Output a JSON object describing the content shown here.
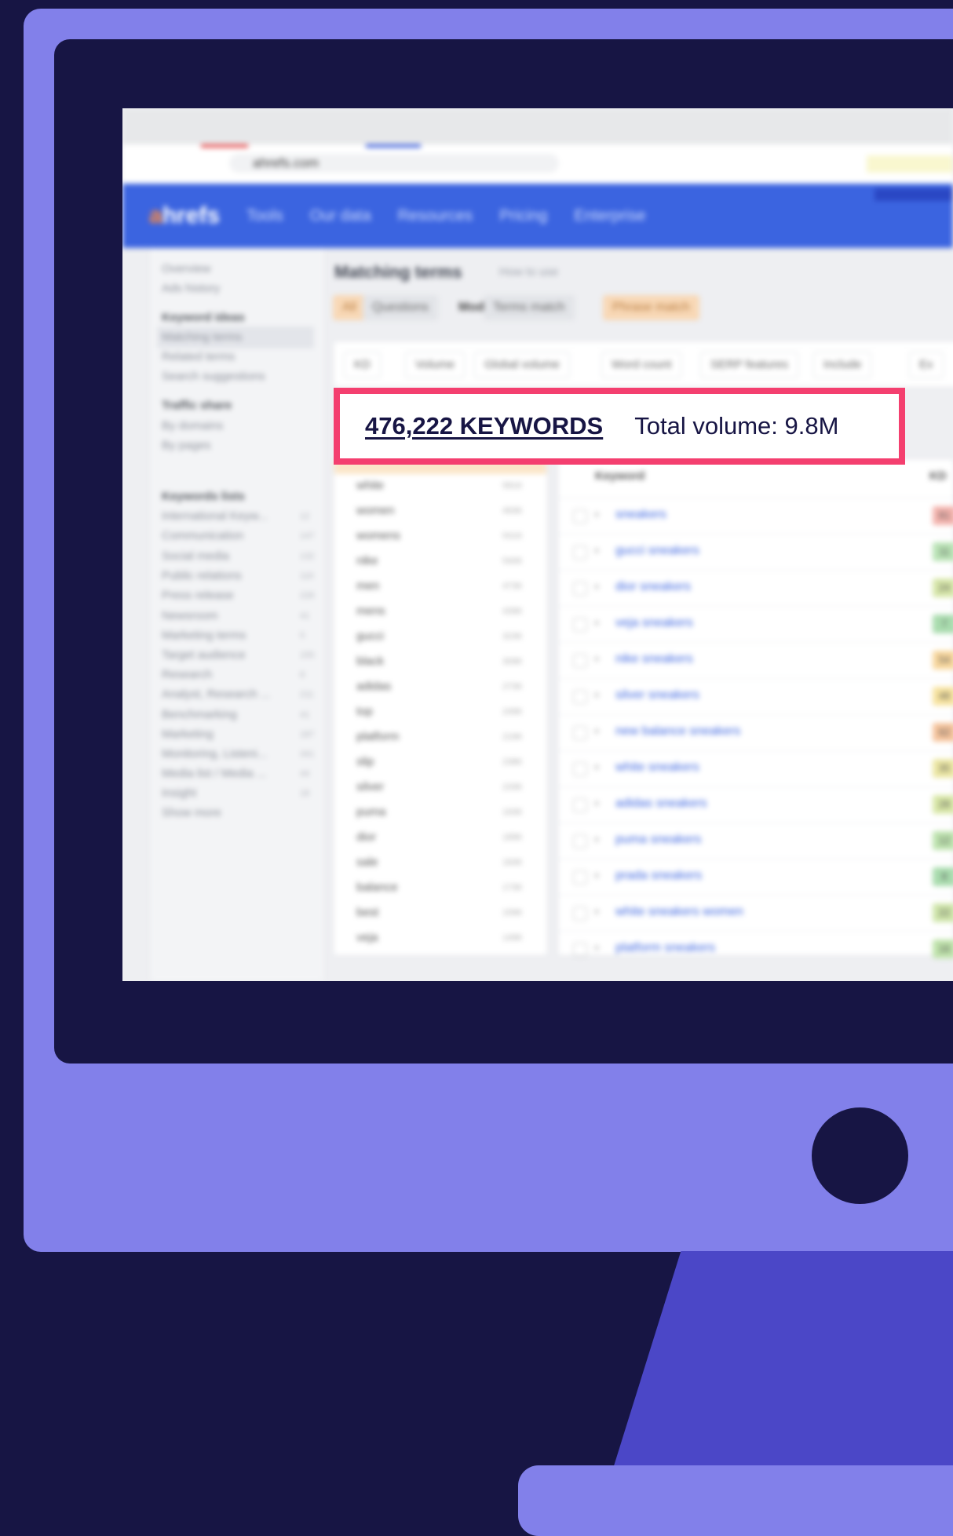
{
  "browser": {
    "url": "ahrefs.com"
  },
  "nav": {
    "logo_a": "a",
    "logo_rest": "hrefs",
    "items": [
      "Tools",
      "Our data",
      "Resources",
      "Pricing",
      "Enterprise"
    ]
  },
  "sidebar": {
    "items": [
      {
        "label": "Overview",
        "head": false
      },
      {
        "label": "Ads history",
        "head": false
      },
      {
        "label": "Keyword ideas",
        "head": true
      },
      {
        "label": "Matching terms",
        "head": false,
        "active": true
      },
      {
        "label": "Related terms",
        "head": false
      },
      {
        "label": "Search suggestions",
        "head": false
      },
      {
        "label": "Traffic share",
        "head": true
      },
      {
        "label": "By domains",
        "head": false
      },
      {
        "label": "By pages",
        "head": false
      },
      {
        "label": "Keywords lists",
        "head": true
      },
      {
        "label": "International Keyw...",
        "head": false,
        "count": "12"
      },
      {
        "label": "Communication",
        "head": false,
        "count": "147"
      },
      {
        "label": "Social media",
        "head": false,
        "count": "132"
      },
      {
        "label": "Public relations",
        "head": false,
        "count": "116"
      },
      {
        "label": "Press release",
        "head": false,
        "count": "228"
      },
      {
        "label": "Newsroom",
        "head": false,
        "count": "41"
      },
      {
        "label": "Marketing terms",
        "head": false,
        "count": "5"
      },
      {
        "label": "Target audience",
        "head": false,
        "count": "155"
      },
      {
        "label": "Research",
        "head": false,
        "count": "8"
      },
      {
        "label": "Analyst, Research ...",
        "head": false,
        "count": "211"
      },
      {
        "label": "Benchmarking",
        "head": false,
        "count": "41"
      },
      {
        "label": "Marketing",
        "head": false,
        "count": "187"
      },
      {
        "label": "Monitoring, Listeni...",
        "head": false,
        "count": "341"
      },
      {
        "label": "Media list / Media ...",
        "head": false,
        "count": "44"
      },
      {
        "label": "Insight",
        "head": false,
        "count": "18"
      },
      {
        "label": "Show more",
        "head": false
      }
    ]
  },
  "main": {
    "title": "Matching terms",
    "how_to": "How to use",
    "tabs": [
      {
        "label": "All",
        "style": "orange"
      },
      {
        "label": "Questions",
        "style": "grey"
      },
      {
        "label": "Mode",
        "style": "plain"
      },
      {
        "label": "Terms match",
        "style": "grey"
      },
      {
        "label": "Phrase match",
        "style": "orange"
      }
    ],
    "filters": [
      "KD",
      "Volume",
      "Global volume",
      "Word count",
      "SERP features",
      "Include",
      "Ex"
    ]
  },
  "terms": [
    {
      "term": "white",
      "count": "581K"
    },
    {
      "term": "women",
      "count": "493K"
    },
    {
      "term": "womens",
      "count": "541K"
    },
    {
      "term": "nike",
      "count": "540K"
    },
    {
      "term": "men",
      "count": "473K"
    },
    {
      "term": "mens",
      "count": "439K"
    },
    {
      "term": "gucci",
      "count": "323K"
    },
    {
      "term": "black",
      "count": "309K"
    },
    {
      "term": "adidas",
      "count": "273K"
    },
    {
      "term": "top",
      "count": "249K"
    },
    {
      "term": "platform",
      "count": "219K"
    },
    {
      "term": "slip",
      "count": "238K"
    },
    {
      "term": "silver",
      "count": "233K"
    },
    {
      "term": "puma",
      "count": "193K"
    },
    {
      "term": "dior",
      "count": "189K"
    },
    {
      "term": "sale",
      "count": "183K"
    },
    {
      "term": "balance",
      "count": "173K"
    },
    {
      "term": "best",
      "count": "159K"
    },
    {
      "term": "veja",
      "count": "149K"
    }
  ],
  "keywords_table": {
    "col_keyword": "Keyword",
    "col_kd": "KD",
    "rows": [
      {
        "kw": "sneakers",
        "kd": "81",
        "color": "#f4b3ad"
      },
      {
        "kw": "gucci sneakers",
        "kd": "11",
        "color": "#b9e3b5"
      },
      {
        "kw": "dior sneakers",
        "kd": "24",
        "color": "#d7e7a9"
      },
      {
        "kw": "veja sneakers",
        "kd": "7",
        "color": "#a9dcae"
      },
      {
        "kw": "nike sneakers",
        "kd": "54",
        "color": "#f8d79d"
      },
      {
        "kw": "silver sneakers",
        "kd": "48",
        "color": "#f7e39f"
      },
      {
        "kw": "new balance sneakers",
        "kd": "62",
        "color": "#f6c49c"
      },
      {
        "kw": "white sneakers",
        "kd": "35",
        "color": "#ece7a3"
      },
      {
        "kw": "adidas sneakers",
        "kd": "28",
        "color": "#d9e8a7"
      },
      {
        "kw": "puma sneakers",
        "kd": "12",
        "color": "#bde3ae"
      },
      {
        "kw": "prada sneakers",
        "kd": "8",
        "color": "#a9dcae"
      },
      {
        "kw": "white sneakers women",
        "kd": "22",
        "color": "#cfe6aa"
      },
      {
        "kw": "platform sneakers",
        "kd": "16",
        "color": "#bfe3ab"
      }
    ]
  },
  "highlight": {
    "keywords_count": "476,222 KEYWORDS",
    "total_volume": "Total volume: 9.8M"
  },
  "colors": {
    "background": "#171544",
    "monitor": "#8280ea",
    "stand": "#4b47c7",
    "highlight_border": "#f43f6f",
    "ahrefs_blue": "#3b64e0"
  }
}
